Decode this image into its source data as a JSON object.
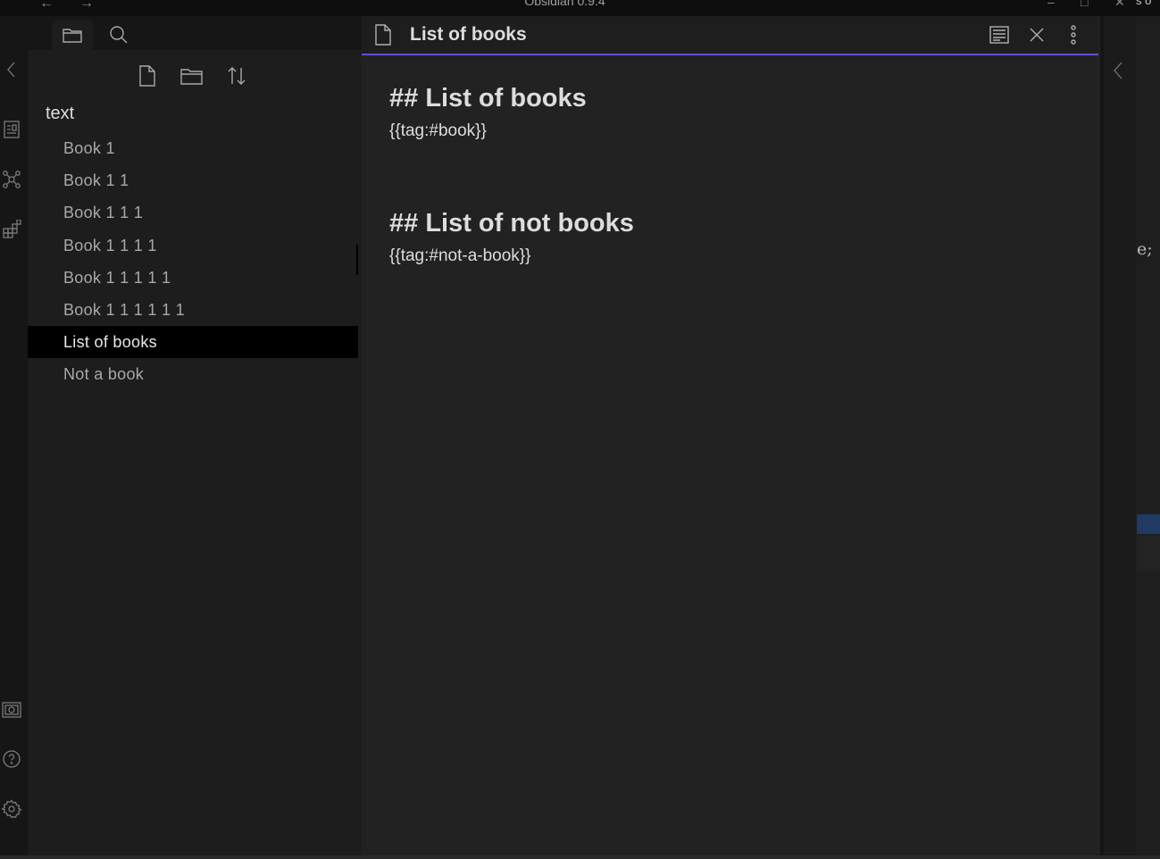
{
  "titlebar": {
    "app_title": "Obsidian 0.9.4",
    "nav_back_icon": "arrow-left-icon",
    "nav_forward_icon": "arrow-right-icon",
    "cut_text": "s o"
  },
  "ribbon": {
    "icons": [
      "collapse-left-icon",
      "templates-icon",
      "graph-icon",
      "command-palette-icon",
      "vault-icon",
      "help-icon",
      "settings-icon"
    ]
  },
  "sidebar": {
    "tabs": [
      "files-tab",
      "search-tab"
    ],
    "toolbar": [
      "new-note-icon",
      "new-folder-icon",
      "sort-icon"
    ],
    "folder": "text",
    "files": [
      {
        "label": "Book 1"
      },
      {
        "label": "Book 1 1"
      },
      {
        "label": "Book 1 1 1"
      },
      {
        "label": "Book 1 1 1 1"
      },
      {
        "label": "Book 1 1 1 1 1"
      },
      {
        "label": "Book 1 1 1 1 1 1"
      },
      {
        "label": "List of books"
      },
      {
        "label": "Not a book"
      }
    ],
    "active_file": "List of books"
  },
  "editor": {
    "tab_title": "List of books",
    "heading1": "## List of books",
    "query1": "{{tag:#book}}",
    "heading2": "## List of not books",
    "query2": "{{tag:#not-a-book}}"
  },
  "underlying_window": {
    "code_fragment": "e;"
  },
  "colors": {
    "accent": "#6a4bd0",
    "active_item_bg": "#000000",
    "editor_bg": "#222222",
    "sidebar_bg": "#1d1d1d"
  }
}
